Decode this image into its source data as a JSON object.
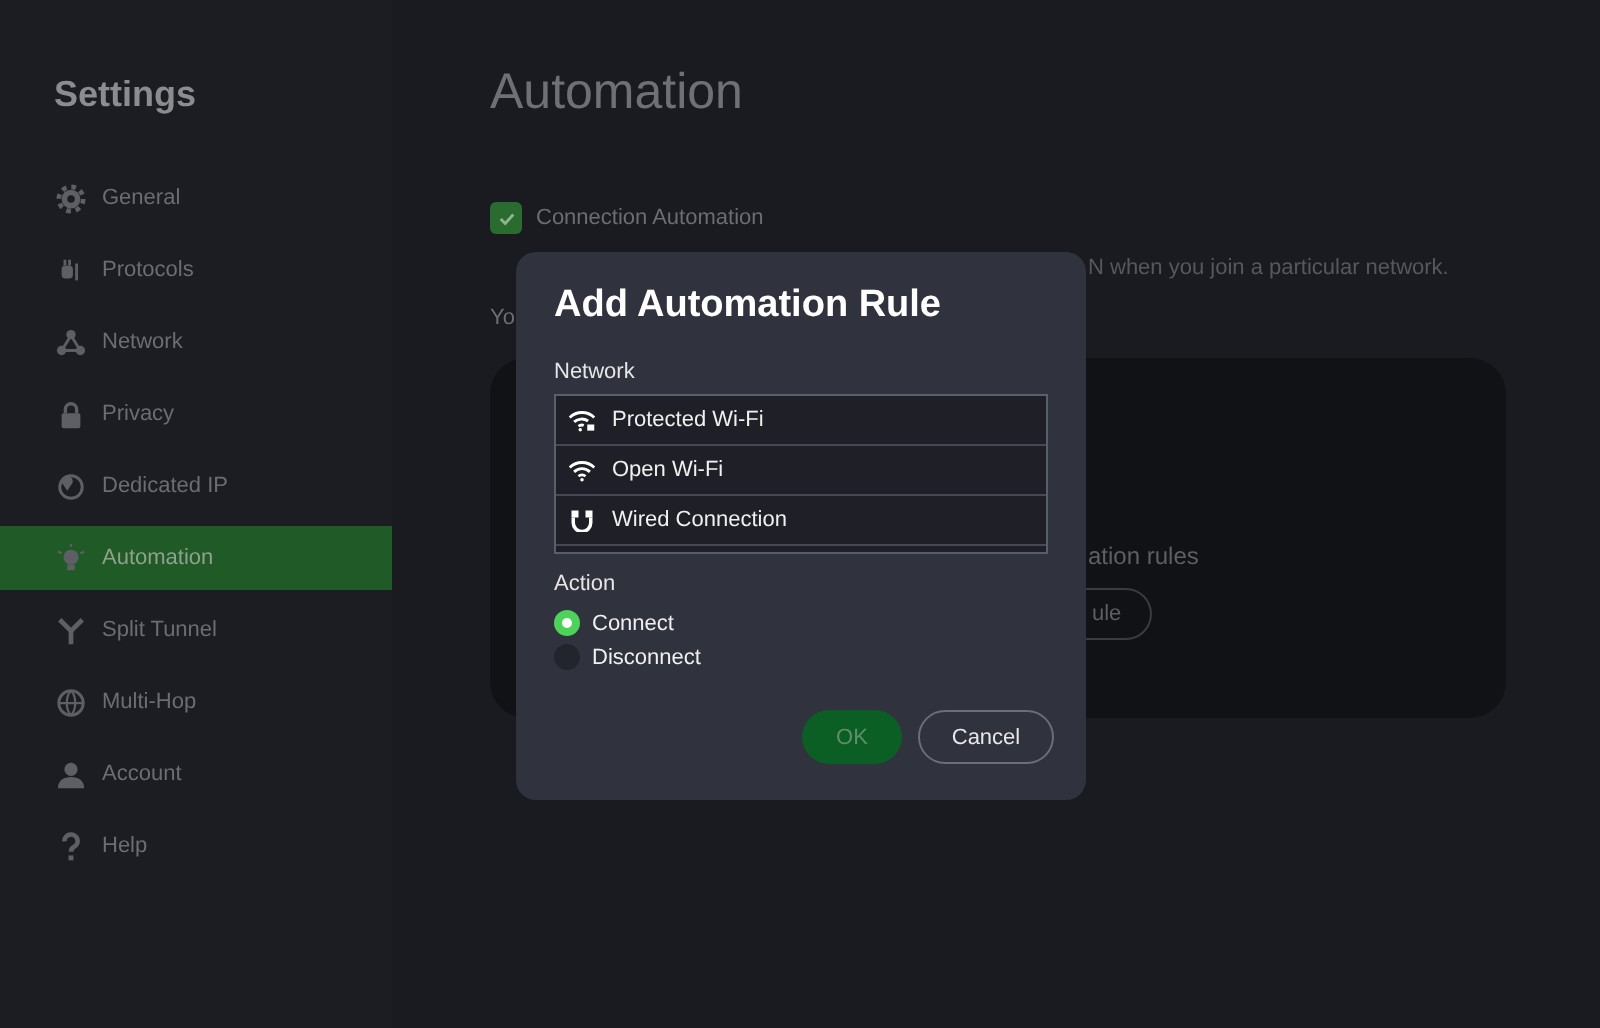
{
  "sidebar": {
    "title": "Settings",
    "items": [
      {
        "label": "General",
        "selected": false
      },
      {
        "label": "Protocols",
        "selected": false
      },
      {
        "label": "Network",
        "selected": false
      },
      {
        "label": "Privacy",
        "selected": false
      },
      {
        "label": "Dedicated IP",
        "selected": false
      },
      {
        "label": "Automation",
        "selected": true
      },
      {
        "label": "Split Tunnel",
        "selected": false
      },
      {
        "label": "Multi-Hop",
        "selected": false
      },
      {
        "label": "Account",
        "selected": false
      },
      {
        "label": "Help",
        "selected": false
      }
    ]
  },
  "page": {
    "title": "Automation",
    "toggle": {
      "label": "Connection Automation",
      "checked": true
    },
    "description": "N when you join a particular network.",
    "intro": "Yo",
    "card": {
      "text": "ation rules",
      "button": "ule"
    }
  },
  "dialog": {
    "title": "Add Automation Rule",
    "network_label": "Network",
    "networks": [
      {
        "label": "Protected Wi-Fi",
        "kind": "protected",
        "selected": false
      },
      {
        "label": "Open Wi-Fi",
        "kind": "open",
        "selected": false
      },
      {
        "label": "Wired Connection",
        "kind": "wired",
        "selected": false
      }
    ],
    "action_label": "Action",
    "actions": [
      {
        "label": "Connect",
        "selected": true
      },
      {
        "label": "Disconnect",
        "selected": false
      }
    ],
    "ok": {
      "label": "OK",
      "disabled": true
    },
    "cancel": {
      "label": "Cancel"
    }
  }
}
